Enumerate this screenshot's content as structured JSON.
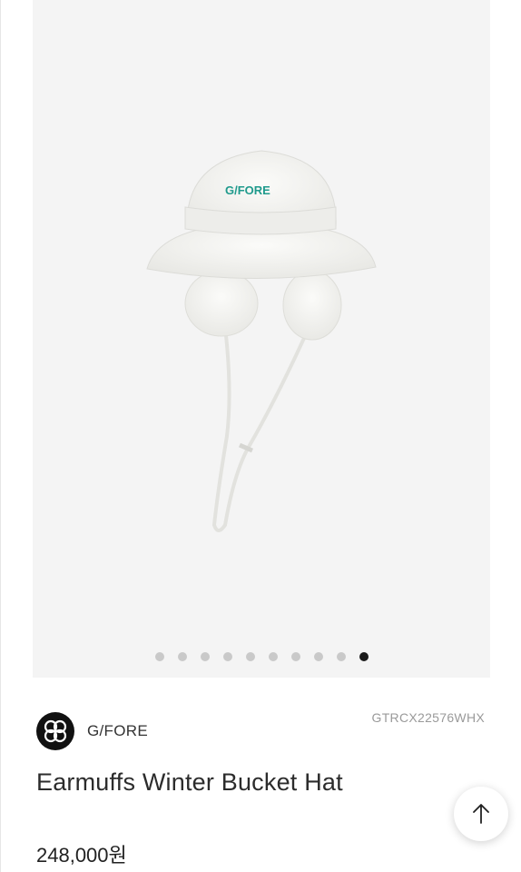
{
  "gallery": {
    "image_alt": "Earmuffs Winter Bucket Hat product photo",
    "hat_embroidery": "G/FORE",
    "image_count": 10,
    "active_index": 9
  },
  "product": {
    "brand_name": "G/FORE",
    "sku": "GTRCX22576WHX",
    "title": "Earmuffs Winter Bucket Hat",
    "price": "248,000원"
  },
  "icons": {
    "brand_logo": "gfore-logo-icon",
    "scroll_top": "arrow-up-icon"
  },
  "colors": {
    "embroidery": "#1f9a8c",
    "active_dot": "#1a1a1a",
    "inactive_dot": "#c9c9c9"
  }
}
